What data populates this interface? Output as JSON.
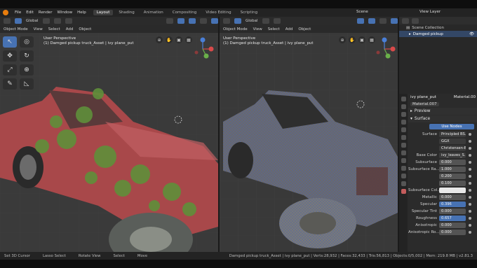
{
  "top_menu": [
    "File",
    "Edit",
    "Render",
    "Window",
    "Help"
  ],
  "workspace_tabs": [
    "Layout",
    "Shading",
    "Animation",
    "Compositing",
    "Video Editing",
    "Scripting"
  ],
  "active_tab": "Layout",
  "scene_label": "Scene",
  "view_layer_label": "View Layer",
  "viewport_left": {
    "mode": "Object Mode",
    "menus": [
      "View",
      "Select",
      "Add",
      "Object"
    ],
    "orientation": "Global",
    "perspective": "User Perspective",
    "object_info": "(1) Damged pickup truck_Asset | ivy plane_put"
  },
  "viewport_right": {
    "mode": "Object Mode",
    "menus": [
      "View",
      "Select",
      "Add",
      "Object"
    ],
    "orientation": "Global",
    "perspective": "User Perspective",
    "object_info": "(1) Damged pickup truck_Asset | ivy plane_put"
  },
  "outliner": {
    "collection": "Scene Collection",
    "object": "Damged pickup"
  },
  "properties": {
    "object_name": "ivy plane_put",
    "material_slot": "Material.00",
    "material_name": "Material.007",
    "preview_label": "Preview",
    "surface_label": "Surface",
    "use_nodes": "Use Nodes",
    "rows": [
      {
        "label": "Surface",
        "value": "Principled BS...",
        "style": "dark"
      },
      {
        "label": "",
        "value": "GGX",
        "style": "dark"
      },
      {
        "label": "",
        "value": "Christensen-B...",
        "style": "dark"
      },
      {
        "label": "Base Color",
        "value": "ivy_leaves_S...",
        "style": "dark"
      },
      {
        "label": "Subsurface",
        "value": "0.000",
        "style": "normal"
      },
      {
        "label": "Subsurface Ra...",
        "value": "1.000",
        "style": "normal"
      },
      {
        "label": "",
        "value": "0.200",
        "style": "normal"
      },
      {
        "label": "",
        "value": "0.100",
        "style": "normal"
      },
      {
        "label": "Subsurface Col...",
        "value": "",
        "style": "white"
      },
      {
        "label": "Metallic",
        "value": "0.000",
        "style": "normal"
      },
      {
        "label": "Specular",
        "value": "0.396",
        "style": "blue"
      },
      {
        "label": "Specular Tint",
        "value": "0.000",
        "style": "normal"
      },
      {
        "label": "Roughness",
        "value": "0.657",
        "style": "blue"
      },
      {
        "label": "Anisotropic",
        "value": "0.000",
        "style": "normal"
      },
      {
        "label": "Anisotropic Ro...",
        "value": "0.000",
        "style": "normal"
      }
    ]
  },
  "statusbar": {
    "items": [
      "Set 3D Cursor",
      "Lasso Select",
      "Rotate View",
      "Select",
      "Move"
    ],
    "stats": "Damged pickup truck_Asset | ivy plane_put | Verts:28,932 | Faces:32,433 | Tris:56,813 | Objects:0/5,002 | Mem: 219.8 MB | v2.81.3"
  },
  "colors": {
    "accent": "#4772b3",
    "truck_red": "#b0474a",
    "ivy_green": "#5f8f3a",
    "wireframe": "#4a5fb0"
  }
}
